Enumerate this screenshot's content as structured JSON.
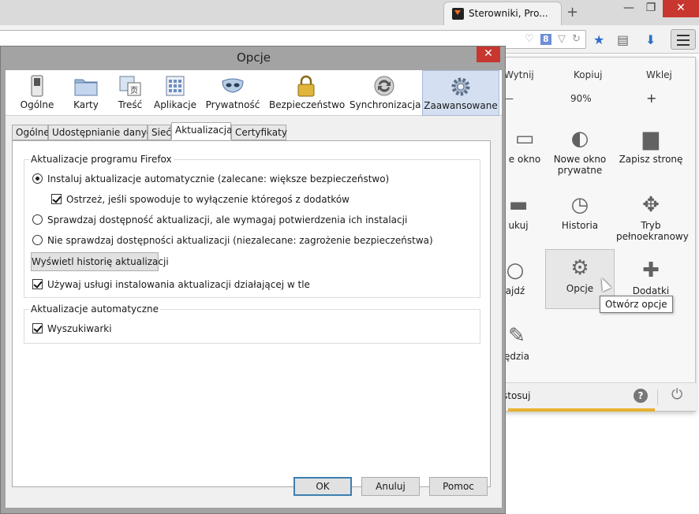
{
  "browser": {
    "tab_title": "Sterowniki, Pro...",
    "new_tab_symbol": "+",
    "window_controls": {
      "minimize": "—",
      "restore": "❐",
      "close": "✕"
    }
  },
  "menu_panel": {
    "edit": {
      "cut": "Wytnij",
      "copy": "Kopiuj",
      "paste": "Wklej"
    },
    "zoom": {
      "minus": "—",
      "level": "90%",
      "plus": "+"
    },
    "items": [
      {
        "label": "e okno",
        "icon": "new-window-icon"
      },
      {
        "label": "Nowe okno prywatne",
        "icon": "private-mask-icon"
      },
      {
        "label": "Zapisz stronę",
        "icon": "save-page-icon"
      },
      {
        "label": "ukuj",
        "icon": "print-icon"
      },
      {
        "label": "Historia",
        "icon": "history-clock-icon"
      },
      {
        "label": "Tryb pełnoekranowy",
        "icon": "fullscreen-icon"
      },
      {
        "label": "ajdź",
        "icon": "find-icon"
      },
      {
        "label": "Opcje",
        "icon": "gear-icon"
      },
      {
        "label": "Dodatki",
        "icon": "puzzle-icon"
      },
      {
        "label": "ędzia",
        "icon": "wrench-icon"
      }
    ],
    "footer_text": "stosuj",
    "tooltip": "Otwórz opcje"
  },
  "dialog": {
    "title": "Opcje",
    "close_symbol": "✕",
    "panes": [
      {
        "label": "Ogólne",
        "icon": "general-switch-icon"
      },
      {
        "label": "Karty",
        "icon": "tabs-folder-icon"
      },
      {
        "label": "Treść",
        "icon": "content-icon"
      },
      {
        "label": "Aplikacje",
        "icon": "applications-icon"
      },
      {
        "label": "Prywatność",
        "icon": "privacy-mask-icon"
      },
      {
        "label": "Bezpieczeństwo",
        "icon": "security-padlock-icon"
      },
      {
        "label": "Synchronizacja",
        "icon": "sync-icon"
      },
      {
        "label": "Zaawansowane",
        "icon": "advanced-gear-icon",
        "selected": true
      }
    ],
    "subtabs": [
      {
        "label": "Ogólne"
      },
      {
        "label": "Udostępnianie danych"
      },
      {
        "label": "Sieć"
      },
      {
        "label": "Aktualizacja",
        "active": true
      },
      {
        "label": "Certyfikaty"
      }
    ],
    "update_group": {
      "title": "Aktualizacje programu Firefox",
      "auto_install": {
        "label": "Instaluj aktualizacje automatycznie (zalecane: większe bezpieczeństwo)",
        "selected": true
      },
      "warn_addons": {
        "label": "Ostrzeż, jeśli spowoduje to wyłączenie któregoś z dodatków",
        "checked": true
      },
      "check_confirm": {
        "label": "Sprawdzaj dostępność aktualizacji, ale wymagaj potwierdzenia ich instalacji",
        "selected": false
      },
      "never_check": {
        "label": "Nie sprawdzaj dostępności aktualizacji (niezalecane: zagrożenie bezpieczeństwa)",
        "selected": false
      },
      "history_button": "Wyświetl historię aktualizacji",
      "background_service": {
        "label": "Używaj usługi instalowania aktualizacji działającej w tle",
        "checked": true
      }
    },
    "auto_group": {
      "title": "Aktualizacje automatyczne",
      "search_engines": {
        "label": "Wyszukiwarki",
        "checked": true
      }
    },
    "buttons": {
      "ok": "OK",
      "cancel": "Anuluj",
      "help": "Pomoc"
    }
  },
  "colors": {
    "selected_pane": "#d4dff1",
    "close_red": "#c7372f",
    "accent_blue": "#2e6ec9"
  }
}
